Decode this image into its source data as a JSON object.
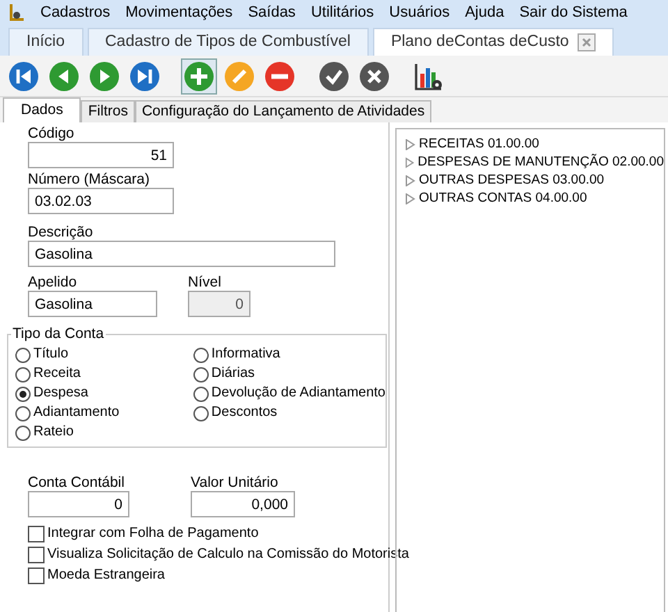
{
  "menu": [
    "Cadastros",
    "Movimentações",
    "Saídas",
    "Utilitários",
    "Usuários",
    "Ajuda",
    "Sair do Sistema"
  ],
  "doc_tabs": [
    {
      "label": "Início",
      "selected": false,
      "closable": false
    },
    {
      "label": "Cadastro de Tipos de Combustível",
      "selected": false,
      "closable": false
    },
    {
      "label": "Plano deContas deCusto",
      "selected": true,
      "closable": true
    }
  ],
  "toolbar": [
    {
      "kind": "first"
    },
    {
      "kind": "prev"
    },
    {
      "kind": "next"
    },
    {
      "kind": "last"
    },
    {
      "kind": "add"
    },
    {
      "kind": "edit"
    },
    {
      "kind": "delete"
    },
    {
      "kind": "confirm"
    },
    {
      "kind": "cancel"
    },
    {
      "kind": "report"
    }
  ],
  "form_tabs": [
    {
      "label": "Dados",
      "selected": true
    },
    {
      "label": "Filtros",
      "selected": false
    },
    {
      "label": "Configuração do Lançamento de Atividades",
      "selected": false
    }
  ],
  "fields": {
    "codigo": {
      "label": "Código",
      "value": "51"
    },
    "numero": {
      "label": "Número (Máscara)",
      "value": "03.02.03"
    },
    "descricao": {
      "label": "Descrição",
      "value": "Gasolina"
    },
    "apelido": {
      "label": "Apelido",
      "value": "Gasolina"
    },
    "nivel": {
      "label": "Nível",
      "value": "0",
      "disabled": true
    }
  },
  "tipo_da_conta": {
    "title": "Tipo da Conta",
    "options": [
      {
        "label": "Título",
        "selected": false
      },
      {
        "label": "Receita",
        "selected": false
      },
      {
        "label": "Despesa",
        "selected": true
      },
      {
        "label": "Adiantamento",
        "selected": false
      },
      {
        "label": "Rateio",
        "selected": false
      },
      {
        "label": "Informativa",
        "selected": false
      },
      {
        "label": "Diárias",
        "selected": false
      },
      {
        "label": "Devolução de Adiantamento",
        "selected": false
      },
      {
        "label": "Descontos",
        "selected": false
      }
    ]
  },
  "conta_contabil": {
    "label": "Conta Contábil",
    "value": "0"
  },
  "valor_unitario": {
    "label": "Valor Unitário",
    "value": "0,000"
  },
  "checkboxes": [
    {
      "label": "Integrar com Folha de Pagamento",
      "checked": false
    },
    {
      "label": "Visualiza Solicitação de Calculo na Comissão do Motorista",
      "checked": false
    },
    {
      "label": "Moeda Estrangeira",
      "checked": false
    }
  ],
  "tree": [
    {
      "label": "RECEITAS 01.00.00",
      "expanded": false
    },
    {
      "label": "DESPESAS DE MANUTENÇÃO 02.00.00",
      "expanded": false
    },
    {
      "label": "OUTRAS DESPESAS 03.00.00",
      "expanded": false
    },
    {
      "label": "OUTRAS CONTAS 04.00.00",
      "expanded": false
    }
  ]
}
